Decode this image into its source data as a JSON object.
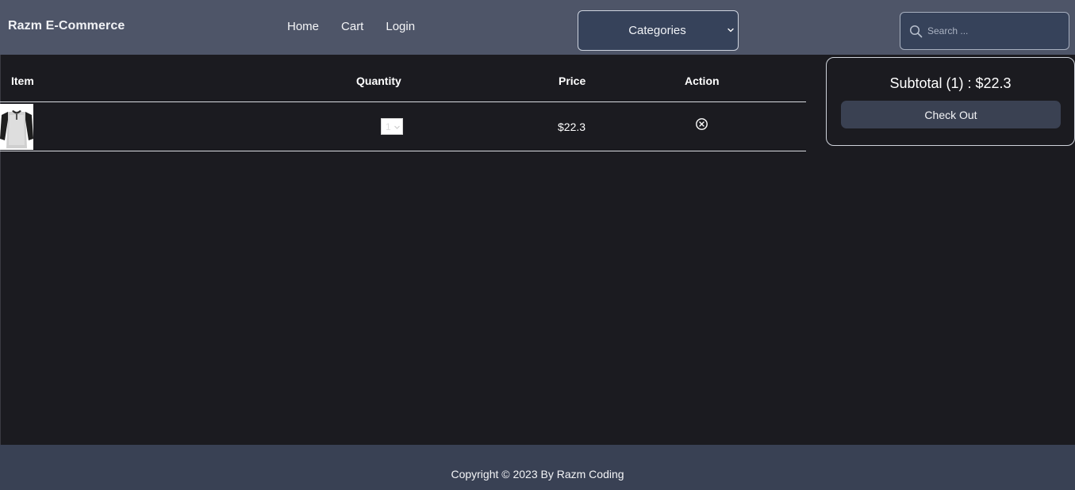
{
  "navbar": {
    "brand": "Razm E-Commerce",
    "links": [
      "Home",
      "Cart",
      "Login"
    ],
    "categories_label": "Categories",
    "search_placeholder": "Search ...",
    "search_icon": "search-icon",
    "categories_icon": "chevron-down-icon"
  },
  "cart": {
    "headers": {
      "item": "Item",
      "quantity": "Quantity",
      "price": "Price",
      "action": "Action"
    },
    "rows": [
      {
        "image": "raglan-tshirt-thumbnail",
        "quantity": "1",
        "price": "$22.3",
        "action_icon": "remove-circle-icon"
      }
    ]
  },
  "summary": {
    "subtotal": "Subtotal (1) : $22.3",
    "checkout_label": "Check Out"
  },
  "footer": {
    "copyright": "Copyright © 2023 By Razm Coding"
  },
  "colors": {
    "navbar_bg": "#4e5568",
    "page_bg": "#1b1b20",
    "control_bg": "#36425a",
    "button_bg": "#3a4152",
    "footer_bg": "#394154"
  }
}
